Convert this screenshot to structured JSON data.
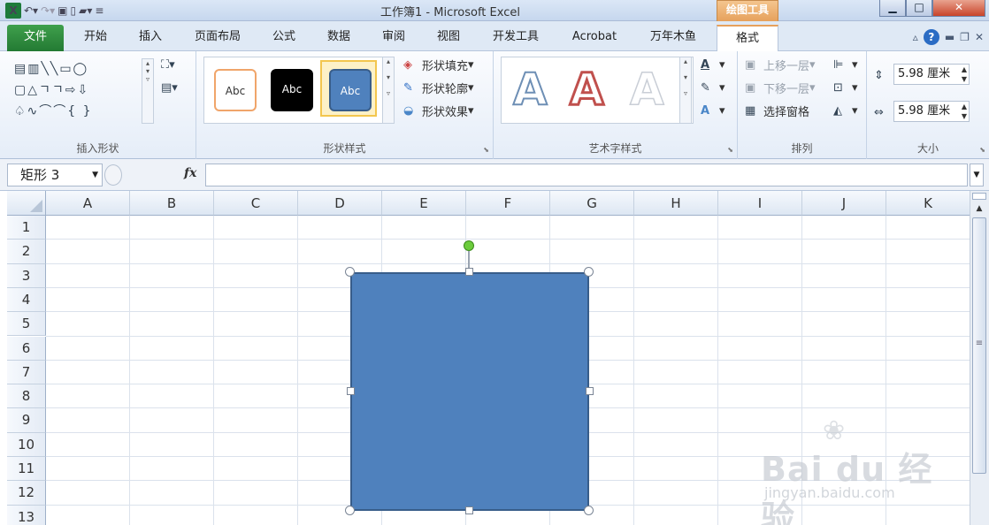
{
  "titlebar": {
    "doc_title": "工作簿1  -  Microsoft Excel",
    "tool_tab_title": "绘图工具"
  },
  "tabs": [
    {
      "label": "文件"
    },
    {
      "label": "开始"
    },
    {
      "label": "插入"
    },
    {
      "label": "页面布局"
    },
    {
      "label": "公式"
    },
    {
      "label": "数据"
    },
    {
      "label": "审阅"
    },
    {
      "label": "视图"
    },
    {
      "label": "开发工具"
    },
    {
      "label": "Acrobat"
    },
    {
      "label": "万年木鱼"
    },
    {
      "label": "格式"
    }
  ],
  "ribbon": {
    "groups": {
      "insert_shapes": "插入形状",
      "shape_styles": "形状样式",
      "wordart_styles": "艺术字样式",
      "arrange": "排列",
      "size": "大小"
    },
    "style_samples": [
      "Abc",
      "Abc",
      "Abc"
    ],
    "shape_commands": {
      "fill": "形状填充",
      "outline": "形状轮廓",
      "effects": "形状效果"
    },
    "wordart_samples": [
      "A",
      "A",
      "A"
    ],
    "arrange_commands": {
      "bring_forward": "上移一层",
      "send_backward": "下移一层",
      "selection_pane": "选择窗格"
    },
    "size": {
      "height": "5.98 厘米",
      "width": "5.98 厘米"
    }
  },
  "formula_bar": {
    "name_box": "矩形 3",
    "fx": "fx",
    "value": ""
  },
  "grid": {
    "columns": [
      "A",
      "B",
      "C",
      "D",
      "E",
      "F",
      "G",
      "H",
      "I",
      "J",
      "K"
    ],
    "rows": [
      "1",
      "2",
      "3",
      "4",
      "5",
      "6",
      "7",
      "8",
      "9",
      "10",
      "11",
      "12",
      "13"
    ]
  },
  "colors": {
    "shape_fill": "#4f81bd",
    "shape_border": "#385d8a",
    "file_tab": "#2e8b3e",
    "drawing_tools_tab": "#e6a15c"
  },
  "watermark": {
    "brand": "Bai du 经验",
    "url": "jingyan.baidu.com"
  }
}
